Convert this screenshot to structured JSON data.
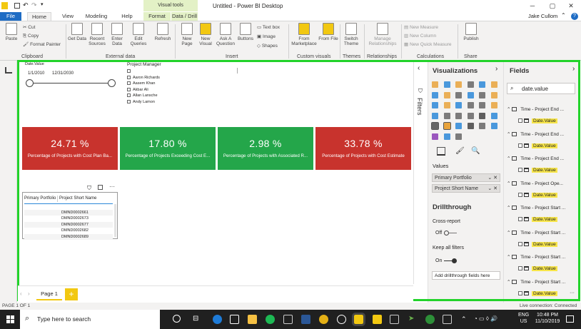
{
  "window": {
    "title": "Untitled - Power BI Desktop",
    "user": "Jake Cullom",
    "context_group": "Visual tools"
  },
  "tabs": [
    "File",
    "Home",
    "View",
    "Modeling",
    "Help",
    "Format",
    "Data / Drill"
  ],
  "ribbon": {
    "clipboard": {
      "cut": "Cut",
      "copy": "Copy",
      "paste": "Paste",
      "format_painter": "Format Painter",
      "group": "Clipboard"
    },
    "external": {
      "get_data": "Get Data",
      "recent": "Recent Sources",
      "enter": "Enter Data",
      "edit": "Edit Queries",
      "refresh": "Refresh",
      "group": "External data"
    },
    "insert": {
      "new_page": "New Page",
      "new_visual": "New Visual",
      "ask": "Ask A Question",
      "buttons": "Buttons",
      "textbox": "Text box",
      "image": "Image",
      "shapes": "Shapes",
      "group": "Insert"
    },
    "custom": {
      "marketplace": "From Marketplace",
      "file": "From File",
      "group": "Custom visuals"
    },
    "themes": {
      "switch": "Switch Theme",
      "group": "Themes"
    },
    "relationships": {
      "manage": "Manage Relationships",
      "group": "Relationships"
    },
    "calculations": {
      "measure": "New Measure",
      "column": "New Column",
      "quick": "New Quick Measure",
      "group": "Calculations"
    },
    "share": {
      "publish": "Publish",
      "group": "Share"
    }
  },
  "canvas": {
    "slicer": {
      "title": "Date.Value",
      "start": "1/1/2010",
      "end": "12/31/2030",
      "start_pos": 0,
      "end_pos": 1
    },
    "pm_slicer": {
      "title": "Project Manager",
      "items": [
        "",
        "Aaron Richards",
        "Aasem Khan",
        "Akbar Ali",
        "Allan Lansche",
        "Andy Lamon"
      ]
    },
    "kpis": [
      {
        "value": "24.71 %",
        "label": "Percentage of Projects with Cost Plan Ba...",
        "color": "#c8332d"
      },
      {
        "value": "17.80 %",
        "label": "Percentage of Projects Exceeding Cost E...",
        "color": "#24a64a"
      },
      {
        "value": "2.98 %",
        "label": "Percentage of Projects with Associated R...",
        "color": "#24a64a"
      },
      {
        "value": "33.78 %",
        "label": "Percentage of Projects with Cost Estimate",
        "color": "#c8332d"
      }
    ],
    "table": {
      "headers": [
        "Primary Portfolio",
        "Project Short Name"
      ],
      "rows": [
        "DMND0002661",
        "DMND0002673",
        "DMND0002677",
        "DMND0002682",
        "DMND0002689"
      ]
    }
  },
  "filters_label": "Filters",
  "viz": {
    "title": "Visualizations",
    "values_label": "Values",
    "wells": [
      "Primary Portfolio",
      "Project Short Name"
    ],
    "drillthrough": "Drillthrough",
    "cross_report": "Cross-report",
    "off": "Off",
    "keep_all": "Keep all filters",
    "on": "On",
    "add_fields": "Add drillthrough fields here"
  },
  "fields": {
    "title": "Fields",
    "search": "date.value",
    "tables": [
      "Time - Project End ...",
      "Time - Project End ...",
      "Time - Project End ...",
      "Time - Project Ope...",
      "Time - Project Start ...",
      "Time - Project Start ...",
      "Time - Project Start ...",
      "Time - Project Start ..."
    ],
    "field": "Date.Value"
  },
  "pages": {
    "current": "Page 1",
    "add": "+"
  },
  "status": {
    "page": "PAGE 1 OF 1",
    "connection": "Live connection: Connected"
  },
  "taskbar": {
    "search": "Type here to search",
    "lang": "ENG",
    "region": "US",
    "time": "10:48 PM",
    "date": "11/10/2019"
  },
  "colors": {
    "red": "#c8332d",
    "green": "#24a64a",
    "highlight": "#22d32a",
    "accent": "#f2c811"
  }
}
